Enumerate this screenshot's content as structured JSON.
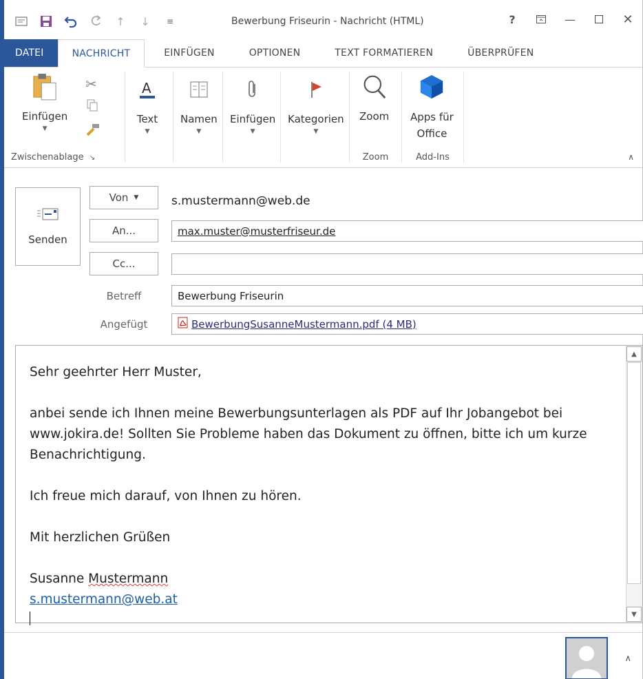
{
  "window": {
    "title": "Bewerbung Friseurin - Nachricht (HTML)",
    "help_label": "?",
    "accent_color": "#2b579a"
  },
  "qat": {
    "icons": [
      "envelope-icon",
      "save-icon",
      "undo-icon",
      "redo-icon",
      "up-arrow-icon",
      "down-arrow-icon",
      "customize-qat-icon"
    ]
  },
  "tabs": [
    "DATEI",
    "NACHRICHT",
    "EINFÜGEN",
    "OPTIONEN",
    "TEXT FORMATIEREN",
    "ÜBERPRÜFEN"
  ],
  "ribbon": {
    "clipboard": {
      "paste_label": "Einfügen",
      "group_label": "Zwischenablage"
    },
    "text_label": "Text",
    "names_label": "Namen",
    "insert_label": "Einfügen",
    "categories_label": "Kategorien",
    "zoom": {
      "button_label": "Zoom",
      "group_label": "Zoom"
    },
    "addins": {
      "button_label_1": "Apps für",
      "button_label_2": "Office",
      "group_label": "Add-Ins"
    }
  },
  "header": {
    "send_label": "Senden",
    "from_label": "Von",
    "from_value": "s.mustermann@web.de",
    "to_label": "An...",
    "to_value": "max.muster@musterfriseur.de",
    "cc_label": "Cc...",
    "cc_value": "",
    "subject_label": "Betreff",
    "subject_value": "Bewerbung Friseurin",
    "attached_label": "Angefügt",
    "attachment": "BewerbungSusanneMustermann.pdf (4 MB)"
  },
  "body": {
    "greeting": "Sehr geehrter Herr Muster,",
    "paragraph": "anbei sende ich Ihnen meine Bewerbungsunterlagen als PDF auf Ihr Jobangebot bei www.jokira.de! Sollten Sie Probleme haben das Dokument zu öffnen, bitte ich um kurze Benachrichtigung.",
    "closing_line": "Ich freue mich darauf, von Ihnen zu hören.",
    "regards": "Mit herzlichen Grüßen",
    "signature_first": "Susanne",
    "signature_last": "Mustermann",
    "signature_email": "s.mustermann@web.at"
  }
}
